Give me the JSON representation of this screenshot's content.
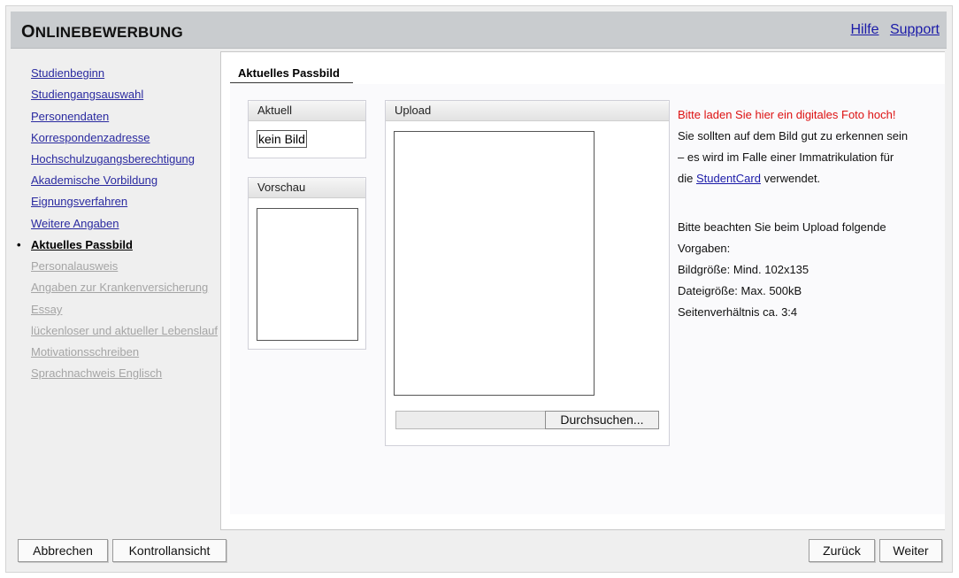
{
  "header": {
    "title_first": "O",
    "title_rest": "NLINEBEWERBUNG",
    "help_link": "Hilfe",
    "support_link": "Support"
  },
  "sidebar": {
    "items": [
      {
        "label": "Studienbeginn",
        "state": "link"
      },
      {
        "label": "Studiengangsauswahl",
        "state": "link"
      },
      {
        "label": "Personendaten",
        "state": "link"
      },
      {
        "label": "Korrespondenzadresse",
        "state": "link"
      },
      {
        "label": "Hochschulzugangsberechtigung",
        "state": "link"
      },
      {
        "label": "Akademische Vorbildung",
        "state": "link"
      },
      {
        "label": "Eignungsverfahren",
        "state": "link"
      },
      {
        "label": "Weitere Angaben",
        "state": "link"
      },
      {
        "label": "Aktuelles Passbild",
        "state": "active"
      },
      {
        "label": "Personalausweis",
        "state": "disabled"
      },
      {
        "label": "Angaben zur Krankenversicherung",
        "state": "disabled"
      },
      {
        "label": "Essay",
        "state": "disabled"
      },
      {
        "label": "lückenloser und aktueller Lebenslauf",
        "state": "disabled"
      },
      {
        "label": "Motivationsschreiben",
        "state": "disabled"
      },
      {
        "label": "Sprachnachweis Englisch",
        "state": "disabled"
      }
    ],
    "bullet": "•"
  },
  "main": {
    "tab_title": "Aktuelles Passbild",
    "current_panel": {
      "title": "Aktuell",
      "value": "kein Bild"
    },
    "preview_panel": {
      "title": "Vorschau"
    },
    "upload_panel": {
      "title": "Upload",
      "browse_label": "Durchsuchen..."
    },
    "info": {
      "warning": "Bitte laden Sie hier ein digitales Foto hoch!",
      "line1": "Sie sollten auf dem Bild gut zu erkennen sein",
      "line2": "– es wird im Falle einer Immatrikulation für",
      "line3_pre": "die ",
      "line3_link": "StudentCard",
      "line3_post": " verwendet.",
      "req_intro_1": "Bitte beachten Sie beim Upload folgende",
      "req_intro_2": "Vorgaben:",
      "req_size": "Bildgröße: Mind. 102x135",
      "req_file": "Dateigröße: Max. 500kB",
      "req_ratio": "Seitenverhältnis ca. 3:4"
    }
  },
  "footer": {
    "cancel": "Abbrechen",
    "control_view": "Kontrollansicht",
    "back": "Zurück",
    "next": "Weiter"
  }
}
